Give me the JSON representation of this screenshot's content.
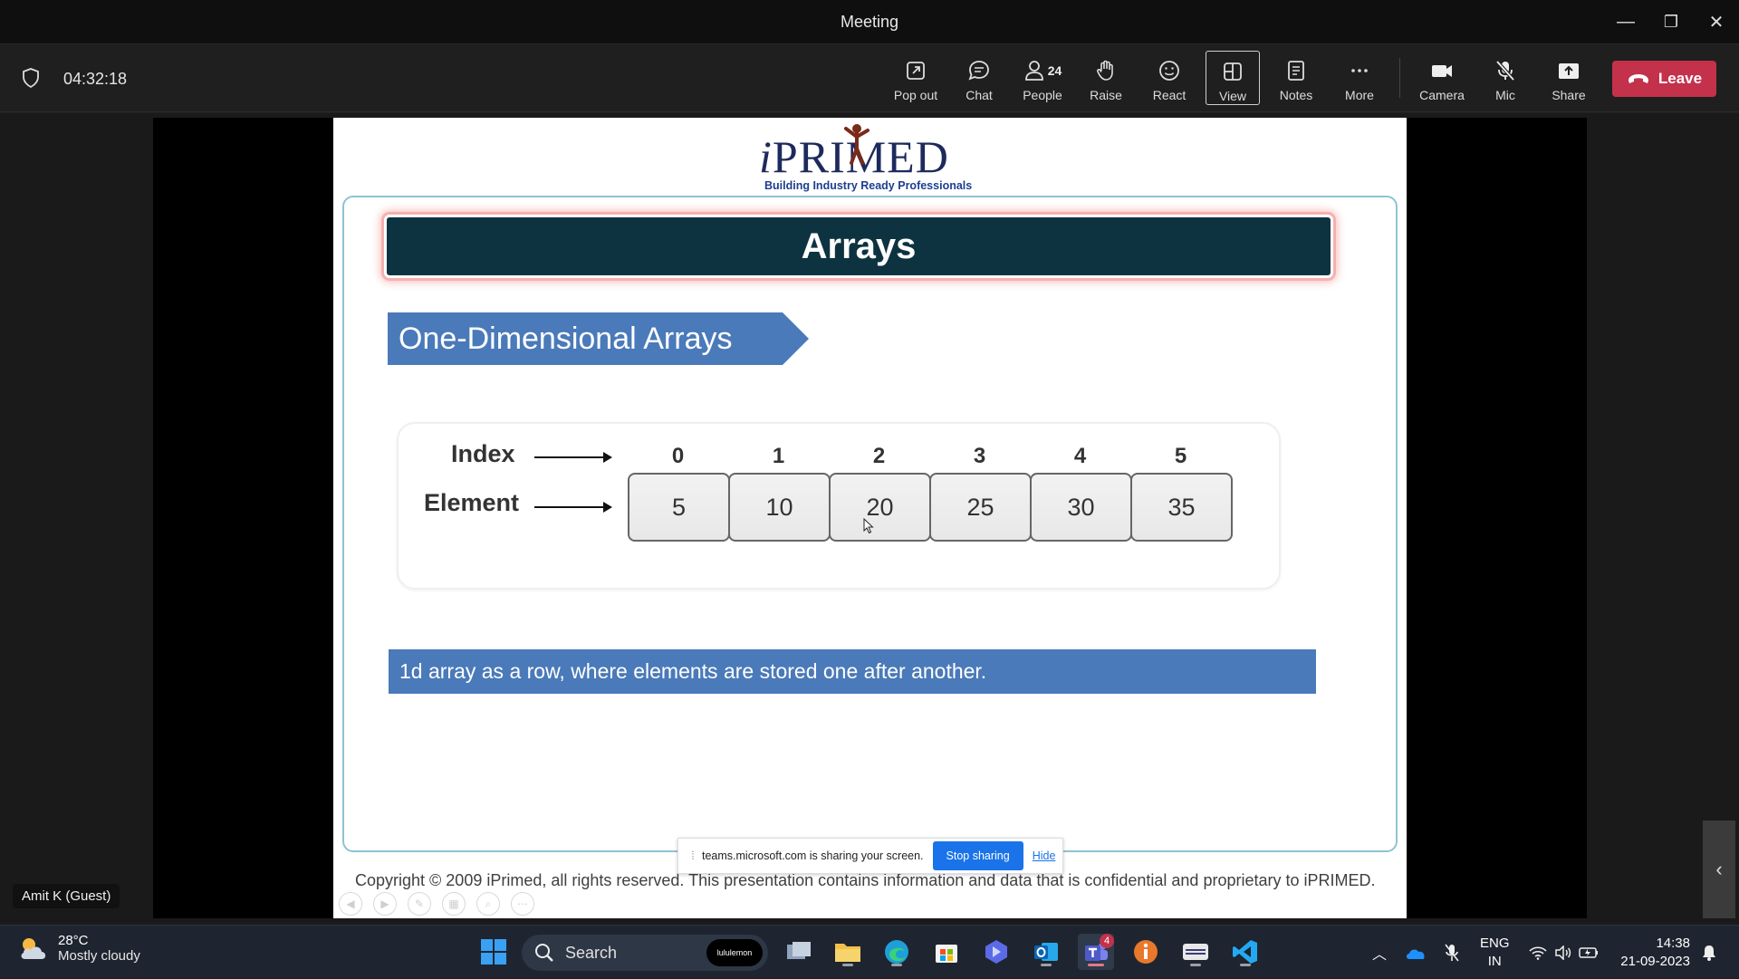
{
  "window": {
    "title": "Meeting",
    "minimize_glyph": "—",
    "restore_glyph": "❐",
    "close_glyph": "✕"
  },
  "meeting": {
    "timer": "04:32:18"
  },
  "toolbar": {
    "buttons": [
      {
        "label": "Pop out",
        "icon": "pop-out-icon"
      },
      {
        "label": "Chat",
        "icon": "chat-icon"
      },
      {
        "label": "People",
        "icon": "people-icon",
        "count": "24"
      },
      {
        "label": "Raise",
        "icon": "raise-hand-icon"
      },
      {
        "label": "React",
        "icon": "react-icon"
      },
      {
        "label": "View",
        "icon": "view-icon"
      },
      {
        "label": "Notes",
        "icon": "notes-icon"
      },
      {
        "label": "More",
        "icon": "more-icon"
      },
      {
        "label": "Camera",
        "icon": "camera-icon"
      },
      {
        "label": "Mic",
        "icon": "mic-off-icon"
      },
      {
        "label": "Share",
        "icon": "share-icon"
      }
    ],
    "leave_label": "Leave"
  },
  "slide": {
    "logo_text_pre": "i",
    "logo_text_rest": "PRIMED",
    "logo_tagline": "Building Industry Ready Professionals",
    "title": "Arrays",
    "ribbon": "One-Dimensional Arrays",
    "index_label": "Index",
    "element_label": "Element",
    "indices": [
      "0",
      "1",
      "2",
      "3",
      "4",
      "5"
    ],
    "elements": [
      "5",
      "10",
      "20",
      "25",
      "30",
      "35"
    ],
    "caption": "1d array as a row, where elements are stored one after another.",
    "copyright": "Copyright © 2009 iPrimed, all rights reserved. This presentation contains information  and data  that is confidential and proprietary to iPRIMED."
  },
  "sharebar": {
    "message": "teams.microsoft.com is sharing your screen.",
    "stop_label": "Stop sharing",
    "hide_label": "Hide"
  },
  "participant": {
    "name": "Amit K (Guest)"
  },
  "taskbar": {
    "weather_temp": "28°C",
    "weather_desc": "Mostly cloudy",
    "search_label": "Search",
    "search_badge": "lululemon",
    "teams_badge": "4",
    "lang_1": "ENG",
    "lang_2": "IN",
    "time": "14:38",
    "date": "21-09-2023"
  },
  "colors": {
    "leave": "#c4314b",
    "title_bar": "#0d3340",
    "accent_blue": "#4a7ab9",
    "stop_btn": "#1a73e8"
  }
}
